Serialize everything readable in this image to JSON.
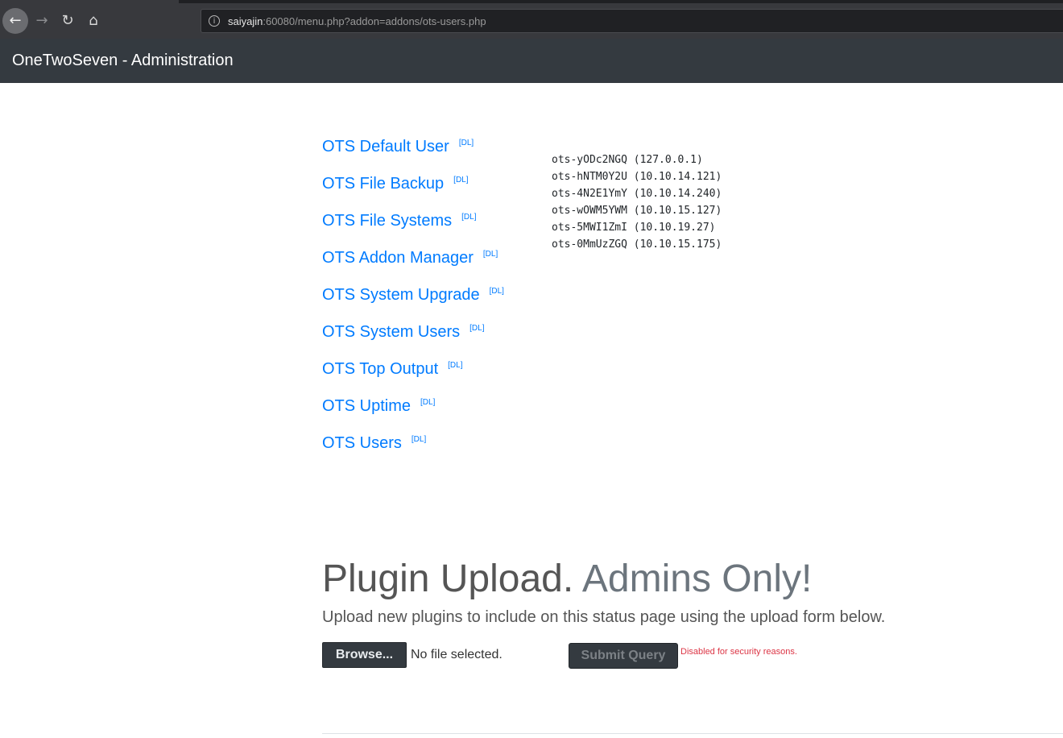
{
  "browser": {
    "url_host": "saiyajin",
    "url_rest": ":60080/menu.php?addon=addons/ots-users.php",
    "back_icon": "arrow-left-icon",
    "forward_icon": "arrow-right-icon",
    "reload_icon": "reload-icon",
    "home_icon": "home-icon",
    "info_icon": "info-icon",
    "info_glyph": "i",
    "back_glyph": "←",
    "forward_glyph": "→",
    "reload_glyph": "↻",
    "home_glyph": "⌂"
  },
  "navbar": {
    "brand": "OneTwoSeven - Administration"
  },
  "addons": [
    {
      "label": "OTS Default User",
      "dl": "[DL]"
    },
    {
      "label": "OTS File Backup",
      "dl": "[DL]"
    },
    {
      "label": "OTS File Systems",
      "dl": "[DL]"
    },
    {
      "label": "OTS Addon Manager",
      "dl": "[DL]"
    },
    {
      "label": "OTS System Upgrade",
      "dl": "[DL]"
    },
    {
      "label": "OTS System Users",
      "dl": "[DL]"
    },
    {
      "label": "OTS Top Output",
      "dl": "[DL]"
    },
    {
      "label": "OTS Uptime",
      "dl": "[DL]"
    },
    {
      "label": "OTS Users",
      "dl": "[DL]"
    }
  ],
  "users_output": [
    "ots-yODc2NGQ (127.0.0.1)",
    "ots-hNTM0Y2U (10.10.14.121)",
    "ots-4N2E1YmY (10.10.14.240)",
    "ots-wOWM5YWM (10.10.15.127)",
    "ots-5MWI1ZmI (10.10.19.27)",
    "ots-0MmUzZGQ (10.10.15.175)"
  ],
  "upload": {
    "title_main": "Plugin Upload.",
    "title_muted": "Admins Only!",
    "description": "Upload new plugins to include on this status page using the upload form below.",
    "browse_label": "Browse...",
    "file_status": "No file selected.",
    "submit_label": "Submit Query",
    "disabled_note": "Disabled for security reasons."
  },
  "colors": {
    "link": "#007bff",
    "navbar": "#343a40",
    "warning": "#dc3545"
  }
}
